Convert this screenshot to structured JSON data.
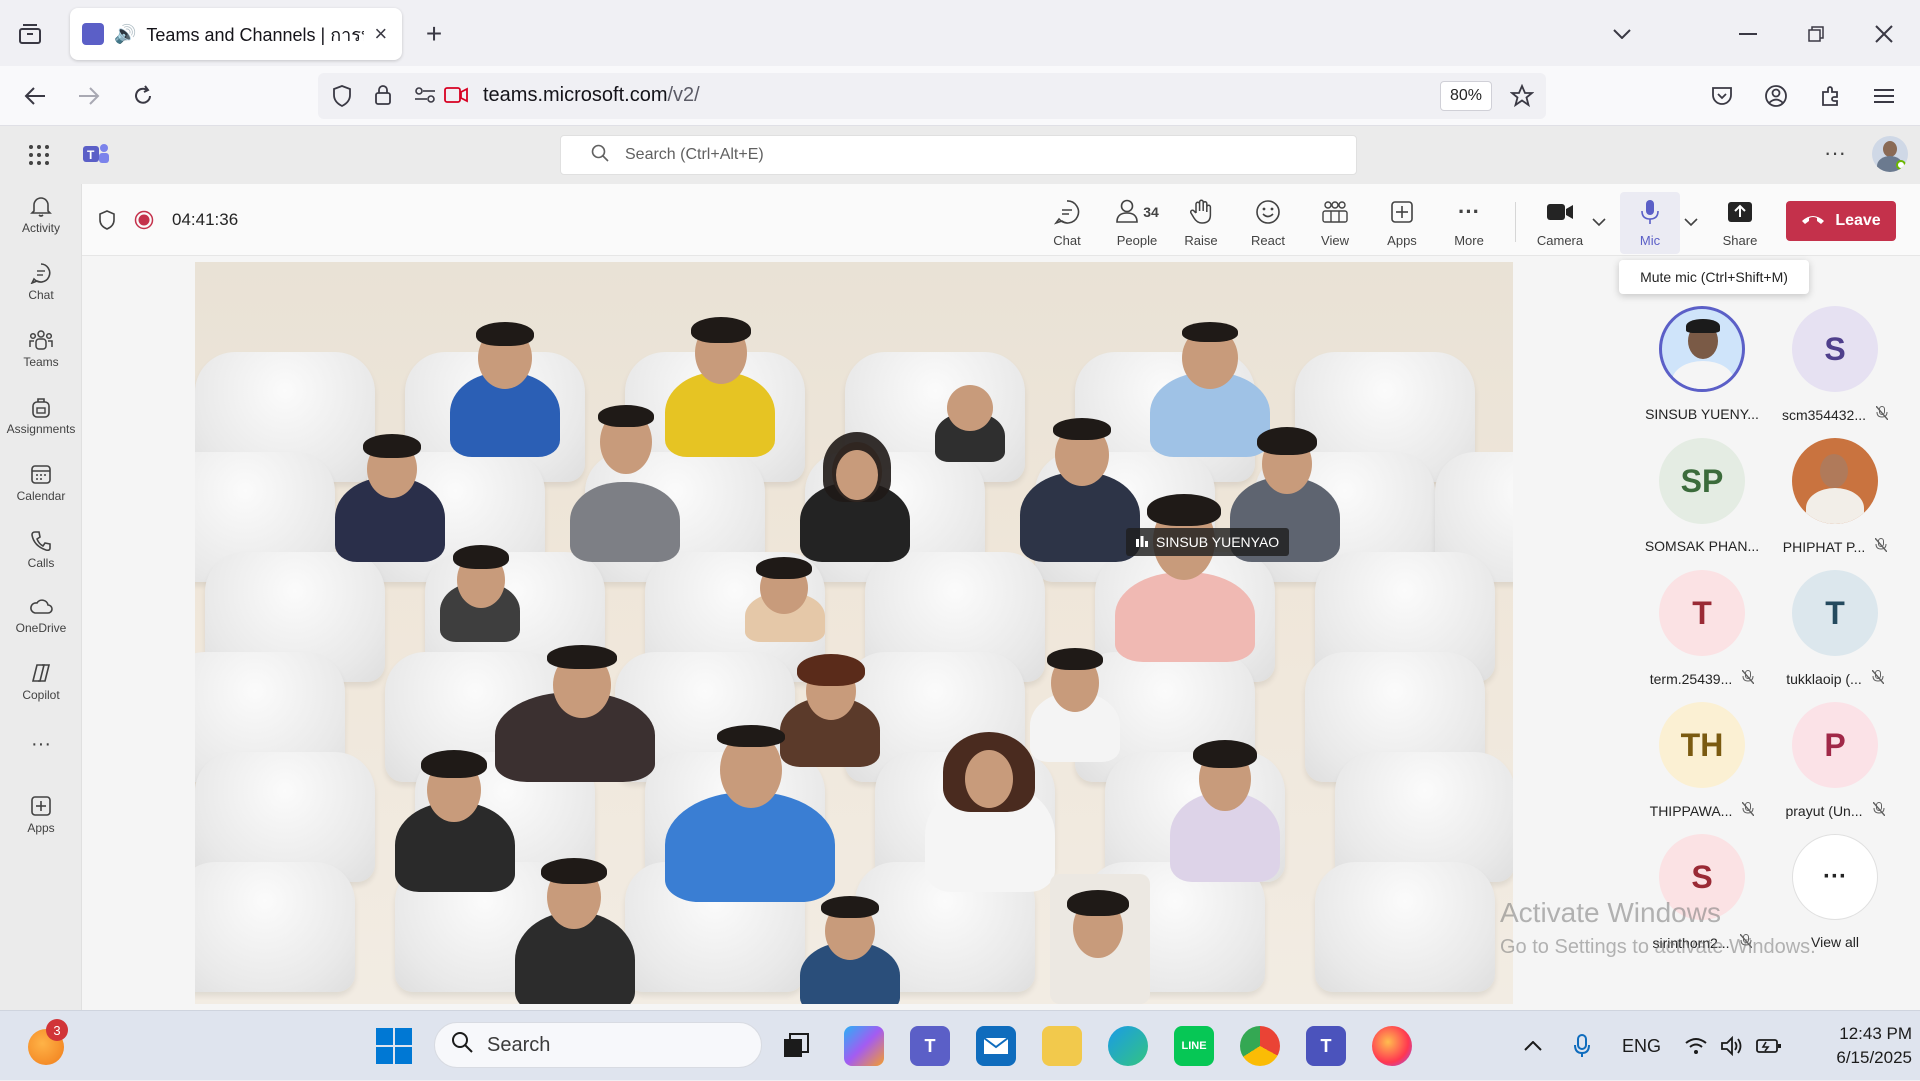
{
  "browser": {
    "tab_title": "Teams and Channels | การป",
    "url_host": "teams.microsoft.com",
    "url_path": "/v2/",
    "zoom": "80%"
  },
  "teams_header": {
    "search_placeholder": "Search (Ctrl+Alt+E)"
  },
  "rail": {
    "items": [
      {
        "label": "Activity",
        "icon": "bell-icon"
      },
      {
        "label": "Chat",
        "icon": "chat-icon"
      },
      {
        "label": "Teams",
        "icon": "teams-icon"
      },
      {
        "label": "Assignments",
        "icon": "backpack-icon"
      },
      {
        "label": "Calendar",
        "icon": "calendar-icon"
      },
      {
        "label": "Calls",
        "icon": "phone-icon"
      },
      {
        "label": "OneDrive",
        "icon": "cloud-icon"
      },
      {
        "label": "Copilot",
        "icon": "copilot-icon"
      },
      {
        "label": "Apps",
        "icon": "apps-plus-icon"
      }
    ]
  },
  "meeting": {
    "elapsed": "04:41:36",
    "people_count": "34",
    "controls": {
      "chat": "Chat",
      "people": "People",
      "raise": "Raise",
      "react": "React",
      "view": "View",
      "apps": "Apps",
      "more": "More",
      "camera": "Camera",
      "mic": "Mic",
      "share": "Share",
      "leave": "Leave"
    },
    "mic_tooltip": "Mute mic (Ctrl+Shift+M)",
    "active_speaker": "SINSUB YUENYAO"
  },
  "participants": [
    {
      "initials": "",
      "name": "SINSUB YUENY...",
      "muted": false,
      "color": "#cfe4fa",
      "fg": "#2b5797",
      "photo": true
    },
    {
      "initials": "S",
      "name": "scm354432...",
      "muted": true,
      "color": "#e6e1f2",
      "fg": "#4f3f8c"
    },
    {
      "initials": "SP",
      "name": "SOMSAK PHAN...",
      "muted": false,
      "color": "#e4ece3",
      "fg": "#3b6b3b"
    },
    {
      "initials": "",
      "name": "PHIPHAT P...",
      "muted": true,
      "color": "#c9733f",
      "fg": "#fff",
      "photo": true
    },
    {
      "initials": "T",
      "name": "term.25439...",
      "muted": true,
      "color": "#fbe2e4",
      "fg": "#9a2a35"
    },
    {
      "initials": "T",
      "name": "tukklaoip (...",
      "muted": true,
      "color": "#dce7ed",
      "fg": "#244a5e"
    },
    {
      "initials": "TH",
      "name": "THIPPAWA...",
      "muted": true,
      "color": "#fbf0d3",
      "fg": "#7a5a10"
    },
    {
      "initials": "P",
      "name": "prayut (Un...",
      "muted": true,
      "color": "#fbe2e7",
      "fg": "#a02848"
    },
    {
      "initials": "S",
      "name": "sirinthorn2...",
      "muted": true,
      "color": "#fbe2e4",
      "fg": "#9a2a35"
    },
    {
      "initials": "···",
      "name": "View all",
      "muted": false,
      "color": "#ffffff",
      "fg": "#242424"
    }
  ],
  "watermark": {
    "line1": "Activate Windows",
    "line2": "Go to Settings to activate Windows."
  },
  "taskbar": {
    "search_placeholder": "Search",
    "notification_count": "3",
    "language": "ENG",
    "time": "12:43 PM",
    "date": "6/15/2025"
  }
}
